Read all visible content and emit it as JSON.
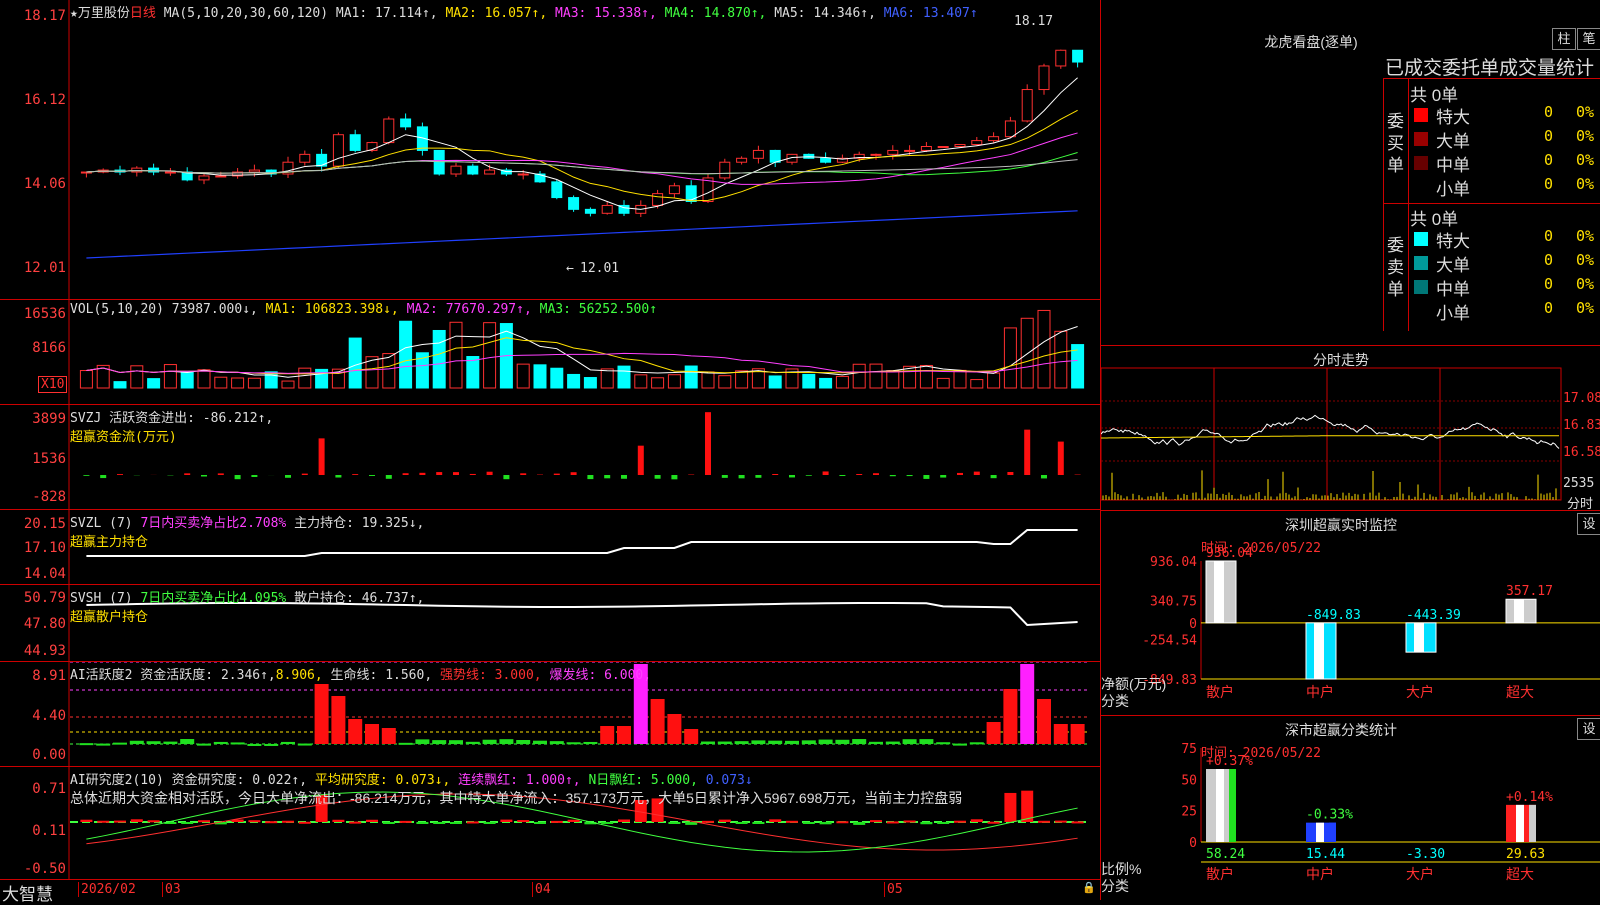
{
  "stock": {
    "name": "万里股份",
    "period": "日线"
  },
  "main_legend": {
    "ma_spec": "MA(5,10,20,30,60,120)",
    "ma1": "MA1: 17.114↑,",
    "ma2": "MA2: 16.057↑,",
    "ma3": "MA3: 15.338↑,",
    "ma4": "MA4: 14.870↑,",
    "ma5": "MA5: 14.346↑,",
    "ma6": "MA6: 13.407↑"
  },
  "main_axis": [
    "18.17",
    "16.12",
    "14.06",
    "12.01"
  ],
  "main_marks": {
    "high": "18.17",
    "low": "12.01"
  },
  "vol_legend": {
    "spec": "VOL(5,10,20)",
    "value": "73987.000↓,",
    "ma1": "MA1: 106823.398↓,",
    "ma2": "MA2: 77670.297↑,",
    "ma3": "MA3: 56252.500↑"
  },
  "vol_axis": [
    "16536",
    "8166"
  ],
  "vol_unit": "X10",
  "svzj": {
    "line1": "SVZJ  活跃资金进出: -86.212↑,",
    "line2": "超赢资金流(万元)",
    "axis": [
      "3899",
      "1536",
      "-828"
    ]
  },
  "svzl": {
    "line1_a": "SVZL (7) ",
    "line1_b": "7日内买卖净占比2.708%",
    "line1_c": " 主力持仓: 19.325↓,",
    "line2": "超赢主力持仓",
    "axis": [
      "20.15",
      "17.10",
      "14.04"
    ]
  },
  "svsh": {
    "line1_a": "SVSH (7) ",
    "line1_b": "7日内买卖净占比4.095%",
    "line1_c": " 散户持仓: 46.737↑,",
    "line2": "超赢散户持仓",
    "axis": [
      "50.79",
      "47.80",
      "44.93"
    ]
  },
  "ai1": {
    "a": "AI活跃度2 资金活跃度: 2.346↑,",
    "b": "8.906,",
    "c": " 生命线: 1.560,",
    "d": "强势线: 3.000,",
    "e": "爆发线: 6.000,",
    "axis": [
      "8.91",
      "4.40",
      "0.00"
    ]
  },
  "ai2": {
    "a": "AI研究度2(10) 资金研究度: 0.022↑,",
    "b": "平均研究度: 0.073↓,",
    "c": "连续飘红: 1.000↑,",
    "d": "N日飘红: 5.000,",
    "e": "0.073↓",
    "summary": "总体近期大资金相对活跃，今日大单净流出：-86.214万元，其中特大单净流入：357.173万元，大单5日累计净入5967.698万元，当前主力控盘弱",
    "axis": [
      "0.71",
      "0.11",
      "-0.50"
    ]
  },
  "bottom": {
    "brand": "大智慧",
    "dates": [
      "2026/02",
      "03",
      "04",
      "05"
    ]
  },
  "lhb": {
    "title": "龙虎看盘(逐单)",
    "btn1": "柱",
    "btn2": "笔",
    "header": "已成交委托单成交量统计",
    "buy_total": "共 0单",
    "sell_total": "共 0单",
    "buy_label": "委买单",
    "sell_label": "委卖单",
    "rows": [
      {
        "label": "特大",
        "n": "0",
        "p": "0%"
      },
      {
        "label": "大单",
        "n": "0",
        "p": "0%"
      },
      {
        "label": "中单",
        "n": "0",
        "p": "0%"
      },
      {
        "label": "小单",
        "n": "0",
        "p": "0%"
      }
    ],
    "buy_colors": [
      "#ff0000",
      "#990000",
      "#660000",
      "#000000"
    ],
    "sell_colors": [
      "#00ffff",
      "#009999",
      "#007777",
      "#000000"
    ]
  },
  "fenshi": {
    "title": "分时走势",
    "axis": [
      "17.08",
      "16.83",
      "16.58"
    ],
    "vol_axis": "2535",
    "vol_label": "分时"
  },
  "monitor": {
    "title": "深圳超赢实时监控",
    "set": "设",
    "time": "时间: 2026/05/22",
    "axis": [
      "936.04",
      "340.75",
      "0",
      "-254.54",
      "-849.83"
    ],
    "ylabel1": "净额(万元)",
    "ylabel2": "分类",
    "bars": [
      {
        "label": "散户",
        "value": 936.04,
        "text": "936.04"
      },
      {
        "label": "中户",
        "value": -849.83,
        "text": "-849.83"
      },
      {
        "label": "大户",
        "value": -443.39,
        "text": "-443.39"
      },
      {
        "label": "超大",
        "value": 357.17,
        "text": "357.17"
      }
    ]
  },
  "classify": {
    "title": "深市超赢分类统计",
    "set": "设",
    "time": "时间: 2026/05/22",
    "axis": [
      "75",
      "50",
      "25",
      "0"
    ],
    "ylabel1": "比例%",
    "ylabel2": "分类",
    "bars": [
      {
        "label": "散户",
        "pct": 58.24,
        "pct_text": "58.24",
        "chg": "+0.37%"
      },
      {
        "label": "中户",
        "pct": 15.44,
        "pct_text": "15.44",
        "chg": "-0.33%"
      },
      {
        "label": "大户",
        "pct": -3.3,
        "pct_text": "-3.30",
        "chg": ""
      },
      {
        "label": "超大",
        "pct": 29.63,
        "pct_text": "29.63",
        "chg": "+0.14%"
      }
    ]
  }
}
